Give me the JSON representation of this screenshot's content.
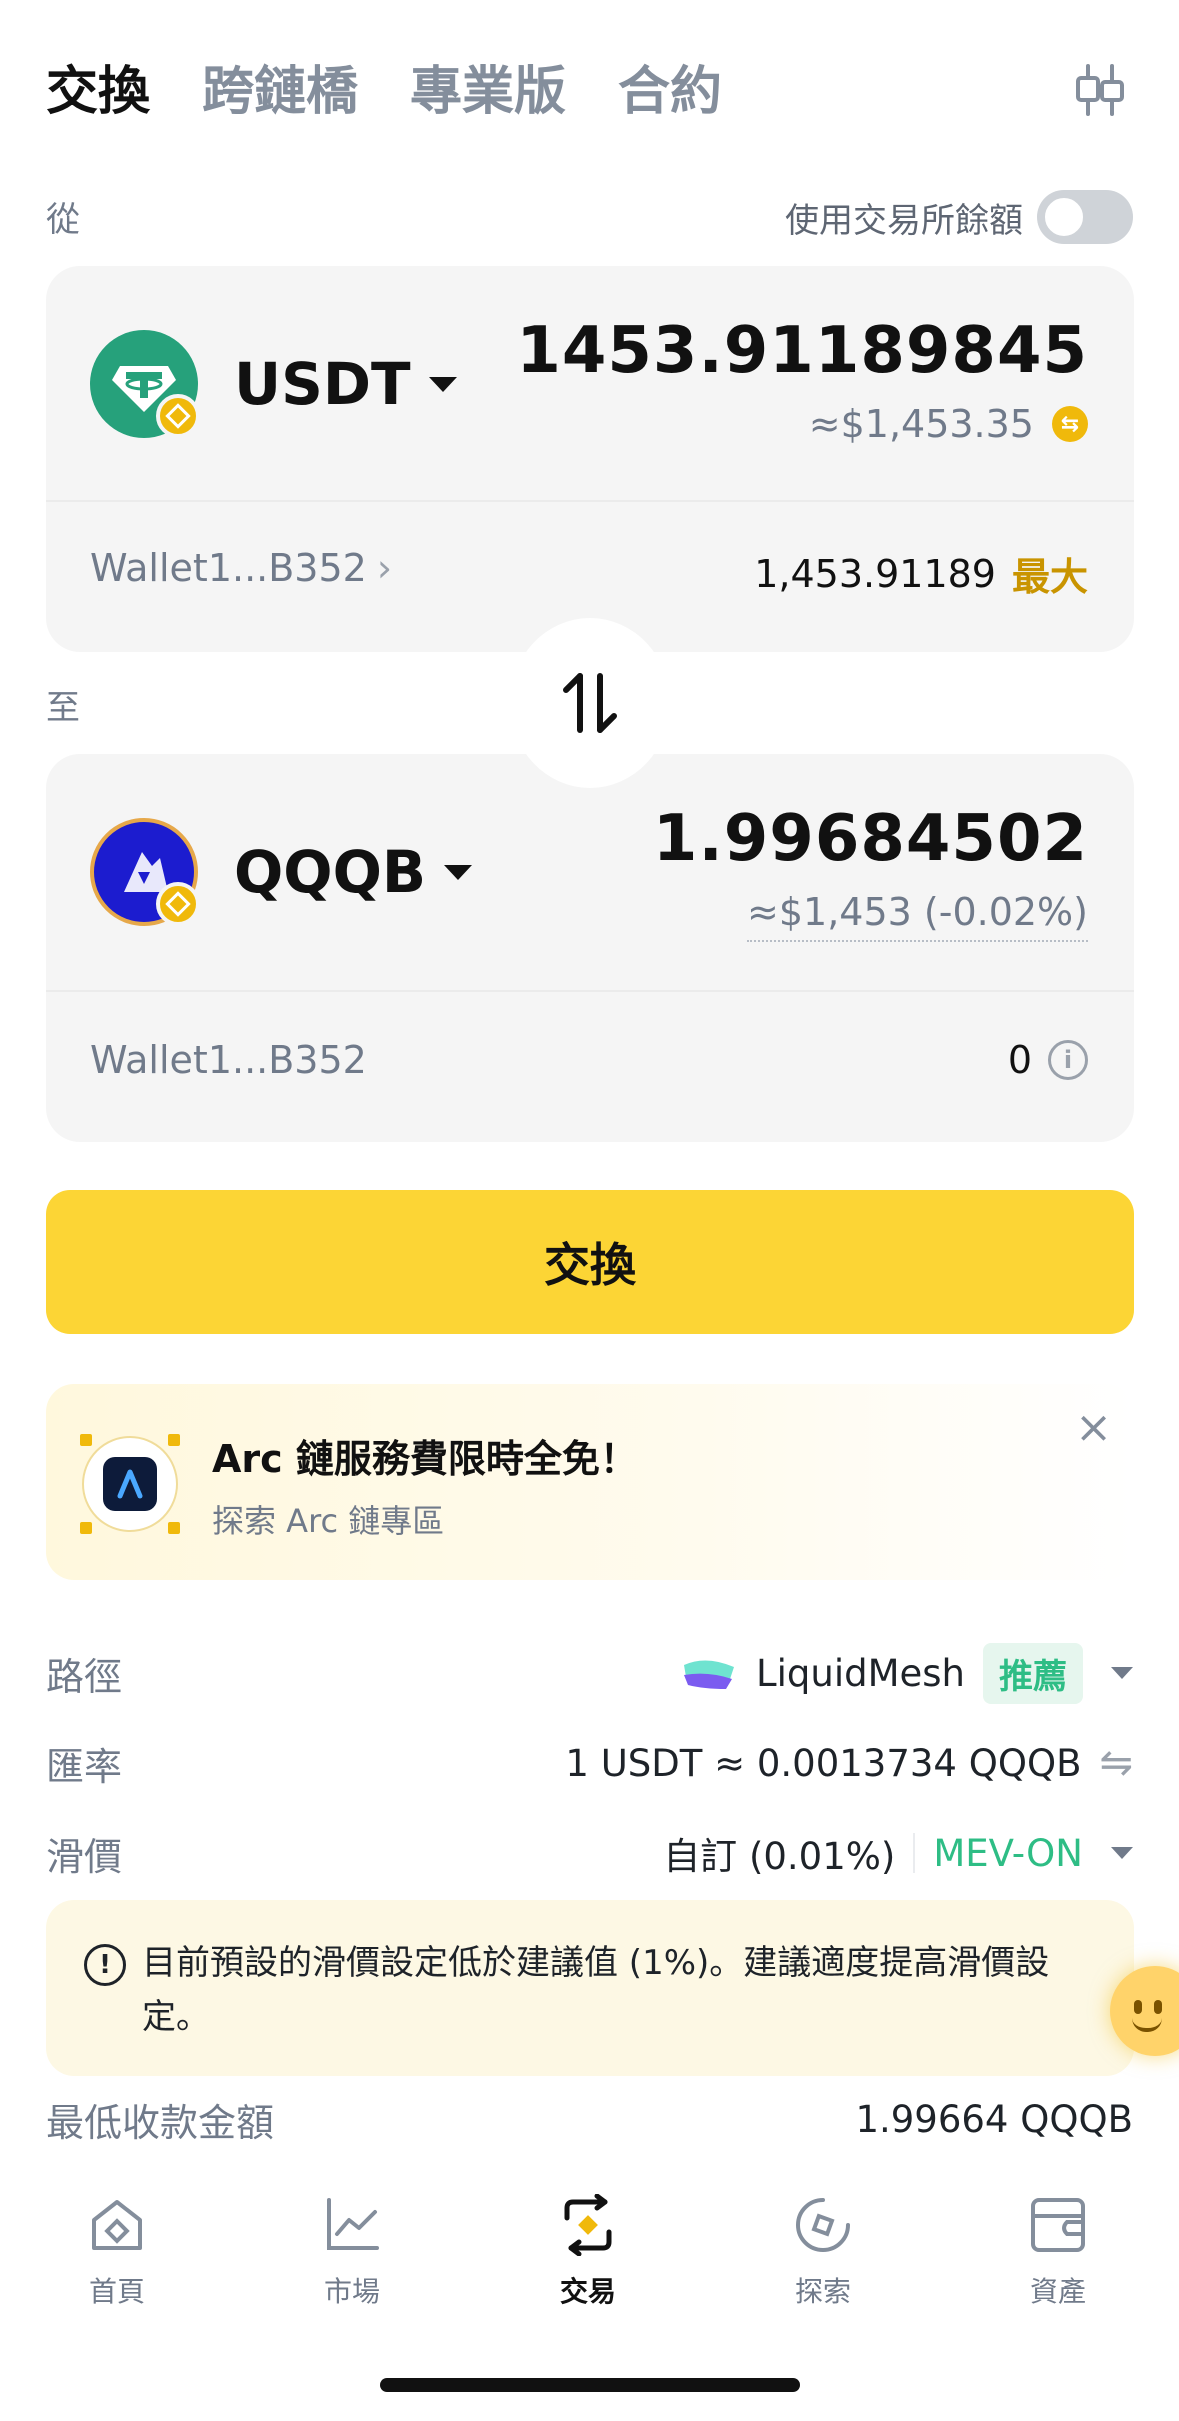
{
  "top_tabs": [
    {
      "label": "交換",
      "active": true
    },
    {
      "label": "跨鏈橋",
      "active": false
    },
    {
      "label": "專業版",
      "active": false
    },
    {
      "label": "合約",
      "active": false
    }
  ],
  "from_section": {
    "label": "從",
    "use_exchange_balance_label": "使用交易所餘額",
    "use_exchange_balance_on": false,
    "token": {
      "symbol": "USDT",
      "icon": "tether-icon"
    },
    "amount": "1453.91189845",
    "usd_value": "≈$1,453.35",
    "wallet": "Wallet1...B352",
    "balance": "1,453.91189",
    "max_label": "最大"
  },
  "to_section": {
    "label": "至",
    "token": {
      "symbol": "QQQB",
      "icon": "qqqb-token-icon"
    },
    "amount": "1.99684502",
    "usd_value": "≈$1,453 (-0.02%)",
    "wallet": "Wallet1...B352",
    "balance": "0"
  },
  "swap_button_label": "交換",
  "promo": {
    "title": "Arc 鏈服務費限時全免！",
    "subtitle": "探索 Arc 鏈專區"
  },
  "details": {
    "route": {
      "label": "路徑",
      "value": "LiquidMesh",
      "badge": "推薦"
    },
    "rate": {
      "label": "匯率",
      "value": "1 USDT ≈ 0.0013734 QQQB"
    },
    "slippage": {
      "label": "滑價",
      "value": "自訂 (0.01%)",
      "mev": "MEV-ON"
    },
    "min_received": {
      "label": "最低收款金額",
      "value": "1.99664 QQQB"
    }
  },
  "warning_text": "目前預設的滑價設定低於建議值 (1%)。建議適度提高滑價設定。",
  "bottom_nav": [
    {
      "label": "首頁",
      "icon": "home-icon",
      "active": false
    },
    {
      "label": "市場",
      "icon": "market-chart-icon",
      "active": false
    },
    {
      "label": "交易",
      "icon": "trade-icon",
      "active": true
    },
    {
      "label": "探索",
      "icon": "explore-icon",
      "active": false
    },
    {
      "label": "資產",
      "icon": "wallet-icon",
      "active": false
    }
  ],
  "colors": {
    "brand_yellow": "#fcd535",
    "accent_gold": "#c99400",
    "green": "#2ebd85",
    "tether_green": "#26a17b",
    "bnb_yellow": "#f0b90b"
  }
}
